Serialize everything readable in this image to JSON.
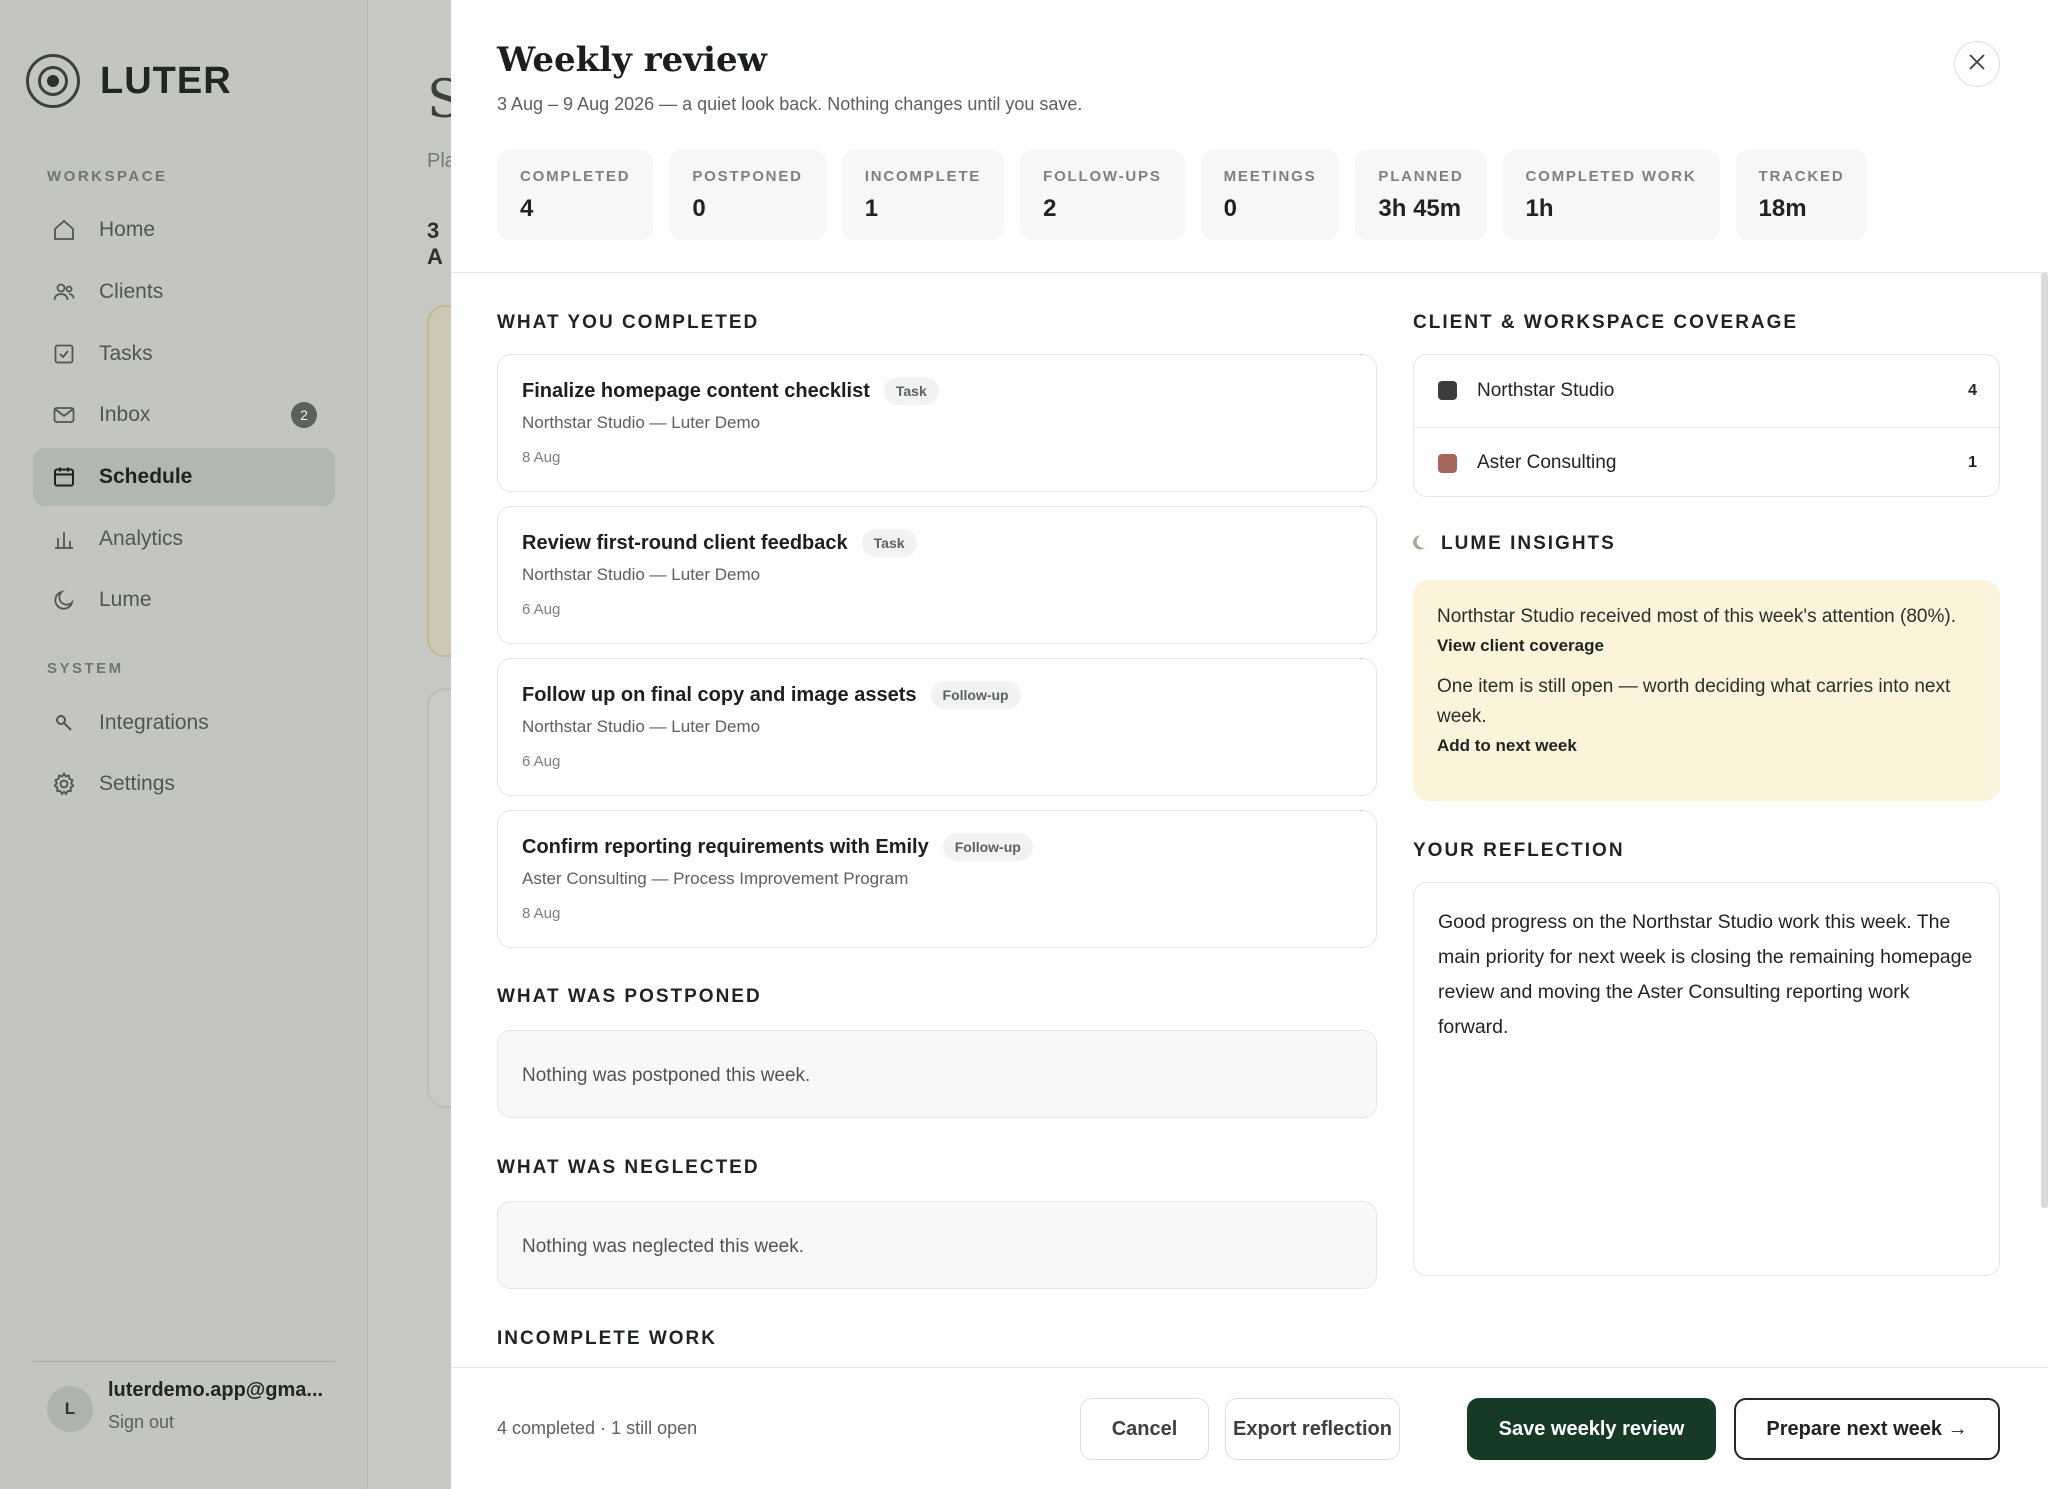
{
  "app": {
    "brand": "LUTER"
  },
  "sidebar": {
    "workspace_label": "WORKSPACE",
    "system_label": "SYSTEM",
    "items": [
      {
        "label": "Home",
        "icon": "home-icon"
      },
      {
        "label": "Clients",
        "icon": "users-icon"
      },
      {
        "label": "Tasks",
        "icon": "checkbox-icon"
      },
      {
        "label": "Inbox",
        "icon": "mail-icon",
        "badge": "2"
      },
      {
        "label": "Schedule",
        "icon": "calendar-icon",
        "active": true
      },
      {
        "label": "Analytics",
        "icon": "bar-chart-icon"
      },
      {
        "label": "Lume",
        "icon": "moon-icon"
      }
    ],
    "system_items": [
      {
        "label": "Integrations",
        "icon": "key-icon"
      },
      {
        "label": "Settings",
        "icon": "gear-icon"
      }
    ],
    "user": {
      "initial": "L",
      "email": "luterdemo.app@gma...",
      "sign_out": "Sign out"
    }
  },
  "background_page": {
    "title_peek": "S",
    "subtitle_peek": "Pla",
    "date_peek": "3 A"
  },
  "modal": {
    "title": "Weekly review",
    "subtitle": "3 Aug – 9 Aug 2026 — a quiet look back. Nothing changes until you save.",
    "stats": [
      {
        "label": "COMPLETED",
        "value": "4"
      },
      {
        "label": "POSTPONED",
        "value": "0"
      },
      {
        "label": "INCOMPLETE",
        "value": "1"
      },
      {
        "label": "FOLLOW-UPS",
        "value": "2"
      },
      {
        "label": "MEETINGS",
        "value": "0"
      },
      {
        "label": "PLANNED",
        "value": "3h 45m"
      },
      {
        "label": "COMPLETED WORK",
        "value": "1h"
      },
      {
        "label": "TRACKED",
        "value": "18m"
      }
    ],
    "completed": {
      "heading": "WHAT YOU COMPLETED",
      "items": [
        {
          "title": "Finalize homepage content checklist",
          "tag": "Task",
          "meta": "Northstar Studio — Luter Demo",
          "date": "8 Aug"
        },
        {
          "title": "Review first-round client feedback",
          "tag": "Task",
          "meta": "Northstar Studio — Luter Demo",
          "date": "6 Aug"
        },
        {
          "title": "Follow up on final copy and image assets",
          "tag": "Follow-up",
          "meta": "Northstar Studio — Luter Demo",
          "date": "6 Aug"
        },
        {
          "title": "Confirm reporting requirements with Emily",
          "tag": "Follow-up",
          "meta": "Aster Consulting — Process Improvement Program",
          "date": "8 Aug"
        }
      ]
    },
    "postponed": {
      "heading": "WHAT WAS POSTPONED",
      "empty": "Nothing was postponed this week."
    },
    "neglected": {
      "heading": "WHAT WAS NEGLECTED",
      "empty": "Nothing was neglected this week."
    },
    "incomplete": {
      "heading": "INCOMPLETE WORK"
    },
    "coverage": {
      "heading": "CLIENT & WORKSPACE COVERAGE",
      "rows": [
        {
          "name": "Northstar Studio",
          "count": "4",
          "color": "#3a3d3a"
        },
        {
          "name": "Aster Consulting",
          "count": "1",
          "color": "#a8655c"
        }
      ]
    },
    "insights": {
      "heading": "LUME INSIGHTS",
      "items": [
        {
          "text": "Northstar Studio received most of this week's attention (80%).",
          "link": "View client coverage"
        },
        {
          "text": "One item is still open — worth deciding what carries into next week.",
          "link": "Add to next week"
        }
      ]
    },
    "reflection": {
      "heading": "YOUR REFLECTION",
      "text": "Good progress on the Northstar Studio work this week. The main priority for next week is closing the remaining homepage review and moving the Aster Consulting reporting work forward."
    },
    "footer": {
      "summary": "4 completed · 1 still open",
      "cancel": "Cancel",
      "export": "Export reflection",
      "save": "Save weekly review",
      "next": "Prepare next week →"
    }
  }
}
